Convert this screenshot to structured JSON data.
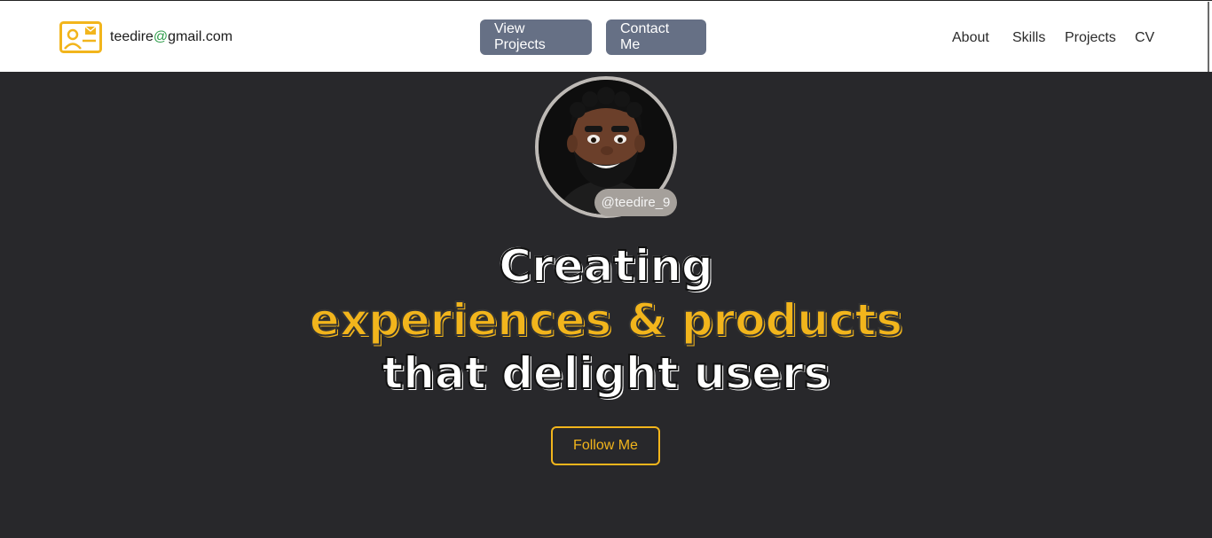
{
  "header": {
    "email_user": "teedire",
    "email_at": "@",
    "email_domain": "gmail.com",
    "icon": "contact-card-mail-icon",
    "accent_color": "#f2b51c"
  },
  "actions": {
    "view_projects": "View Projects",
    "contact_me": "Contact Me"
  },
  "nav": {
    "items": [
      "About",
      "Skills",
      "Projects",
      "CV"
    ]
  },
  "profile": {
    "handle": "@teedire_9",
    "avatar": "3d-avatar-bearded-man"
  },
  "hero": {
    "line1": "Creating",
    "line2": "experiences & products",
    "line3": "that delight users"
  },
  "cta": {
    "follow": "Follow Me"
  },
  "colors": {
    "background": "#28282b",
    "header_bg": "#ffffff",
    "button_bg": "#667085",
    "accent": "#f2b51c"
  }
}
